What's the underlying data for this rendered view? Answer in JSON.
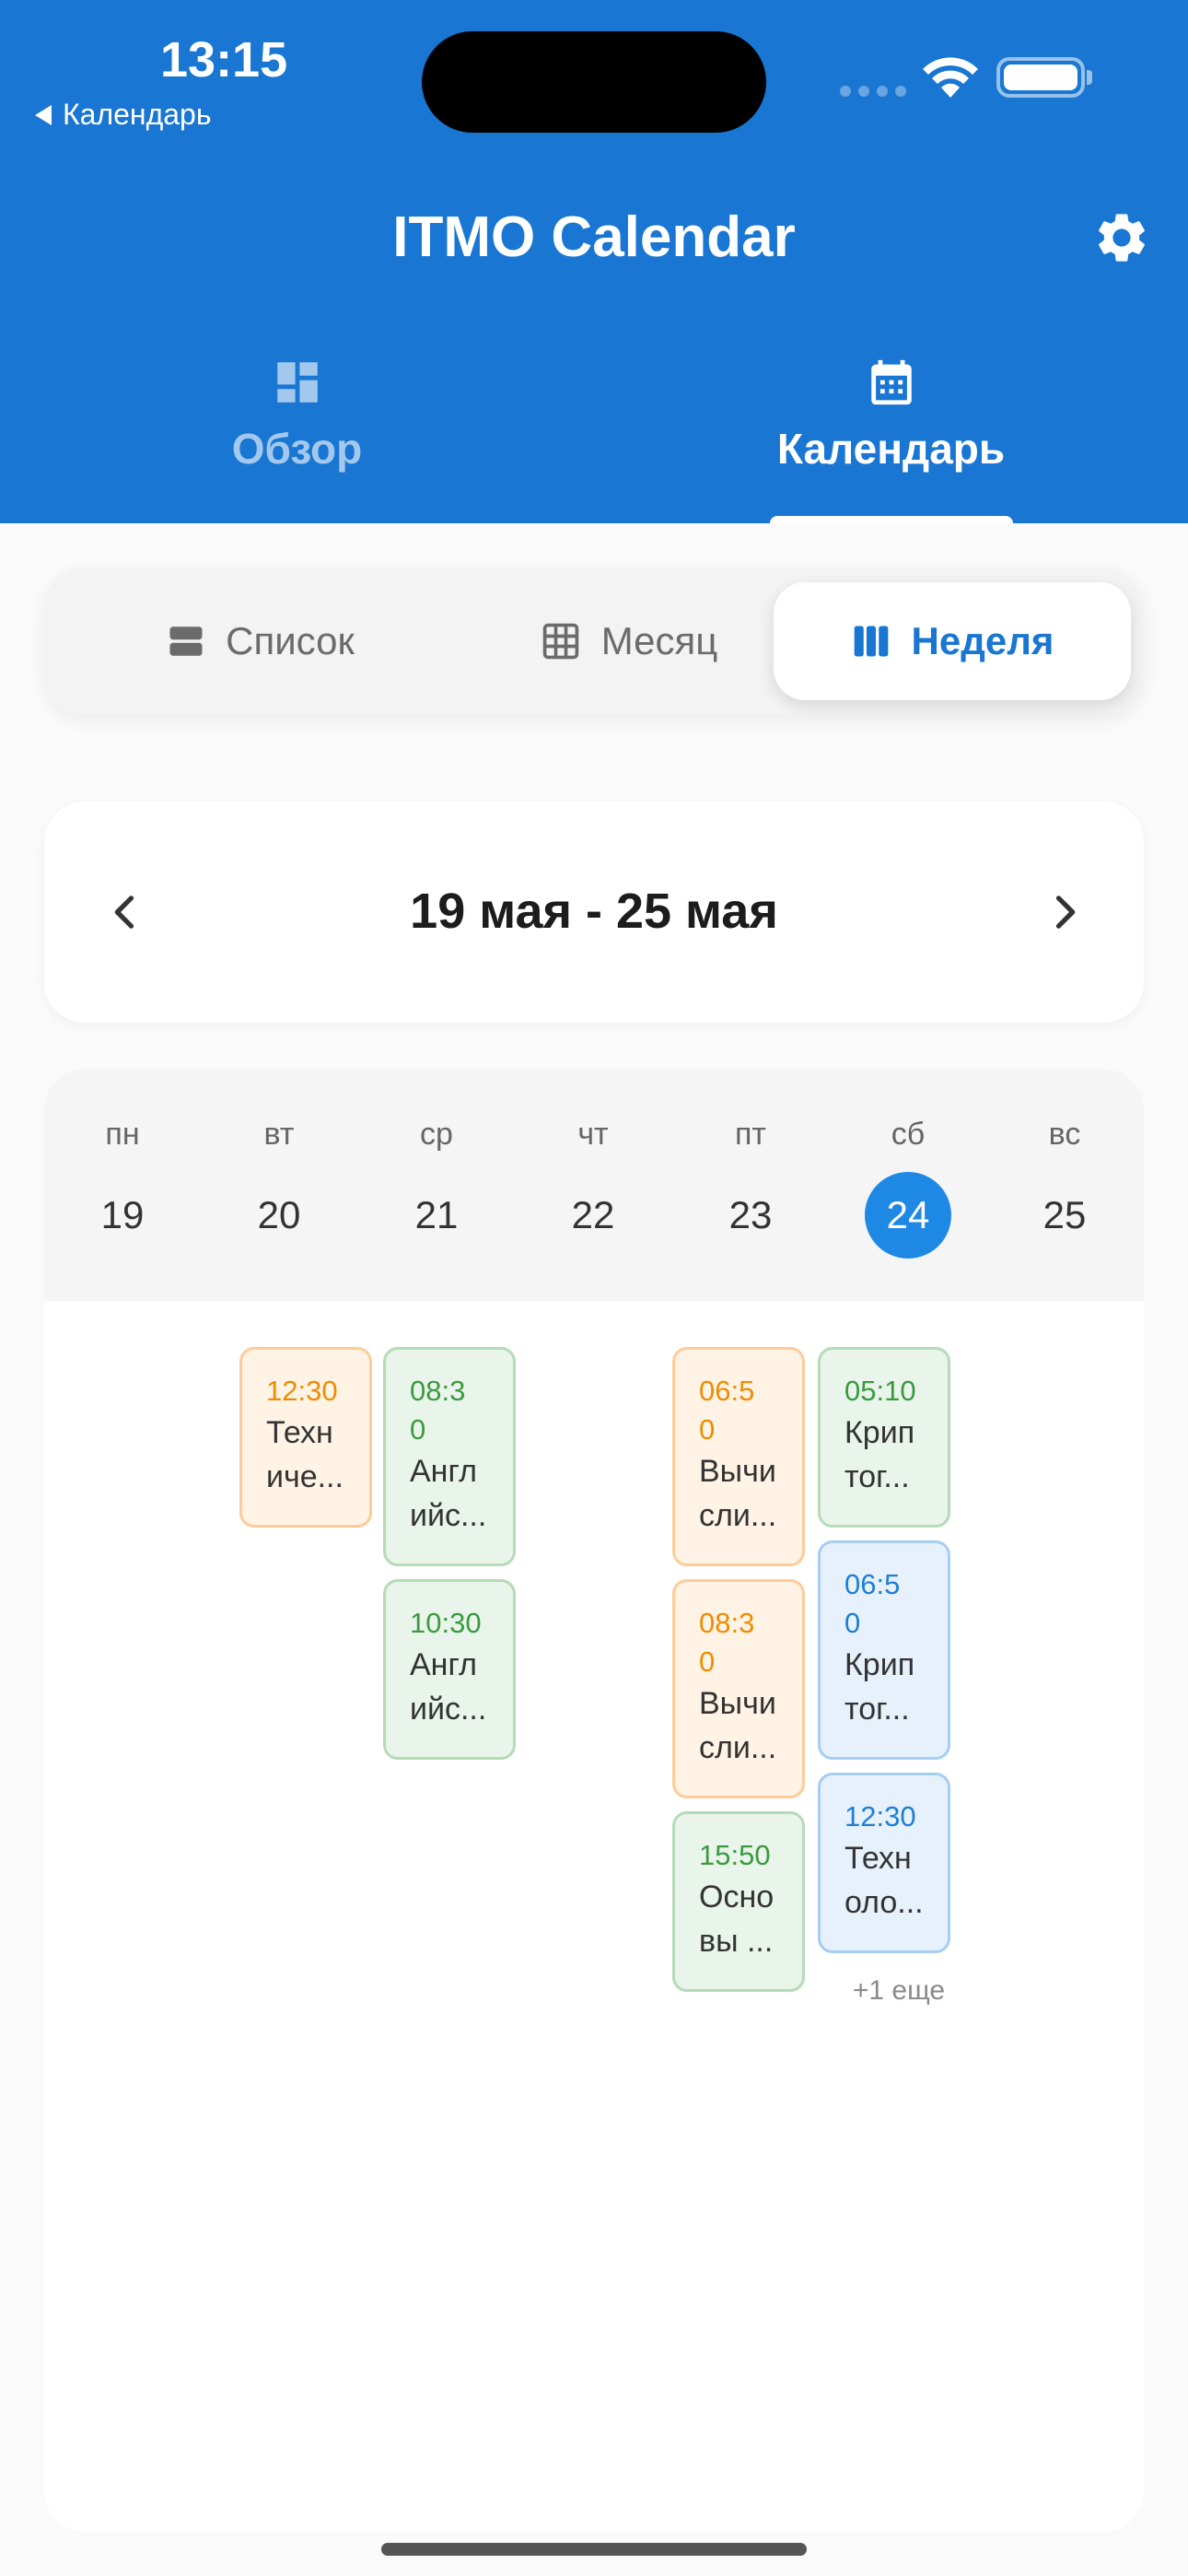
{
  "status": {
    "time": "13:15",
    "back_label": "Календарь"
  },
  "header": {
    "title": "ITMO Calendar",
    "tabs": [
      {
        "label": "Обзор",
        "icon": "dashboard-icon",
        "active": false
      },
      {
        "label": "Календарь",
        "icon": "calendar-icon",
        "active": true
      }
    ]
  },
  "view_switch": {
    "options": [
      {
        "label": "Список",
        "icon": "list-icon"
      },
      {
        "label": "Месяц",
        "icon": "grid-icon"
      },
      {
        "label": "Неделя",
        "icon": "week-columns-icon"
      }
    ],
    "selected": "Неделя"
  },
  "week_nav": {
    "range": "19 мая - 25 мая"
  },
  "week": {
    "days": [
      {
        "name": "пн",
        "num": "19"
      },
      {
        "name": "вт",
        "num": "20"
      },
      {
        "name": "ср",
        "num": "21"
      },
      {
        "name": "чт",
        "num": "22"
      },
      {
        "name": "пт",
        "num": "23"
      },
      {
        "name": "сб",
        "num": "24",
        "today": true
      },
      {
        "name": "вс",
        "num": "25"
      }
    ]
  },
  "events": {
    "tue_1": {
      "time": "12:30",
      "title_l1": "Техн",
      "title_l2": "иче...",
      "color": "#ef8c00"
    },
    "wed_1": {
      "time_l1": "08:3",
      "time_l2": "0",
      "title_l1": "Англ",
      "title_l2": "ийс...",
      "color": "#3b9a40"
    },
    "wed_2": {
      "time": "10:30",
      "title_l1": "Англ",
      "title_l2": "ийс...",
      "color": "#3b9a40"
    },
    "fri_1": {
      "time_l1": "06:5",
      "time_l2": "0",
      "title_l1": "Вычи",
      "title_l2": "сли...",
      "color": "#ef8c00"
    },
    "fri_2": {
      "time_l1": "08:3",
      "time_l2": "0",
      "title_l1": "Вычи",
      "title_l2": "сли...",
      "color": "#ef8c00"
    },
    "fri_3": {
      "time": "15:50",
      "title_l1": "Осно",
      "title_l2": "вы ...",
      "color": "#3b9a40"
    },
    "sat_1": {
      "time": "05:10",
      "title_l1": "Крип",
      "title_l2": "тог...",
      "color": "#3b9a40"
    },
    "sat_2": {
      "time_l1": "06:5",
      "time_l2": "0",
      "title_l1": "Крип",
      "title_l2": "тог...",
      "color": "#1f7fd2"
    },
    "sat_3": {
      "time": "12:30",
      "title_l1": "Техн",
      "title_l2": "оло...",
      "color": "#1f7fd2"
    },
    "sat_more": "+1 еще"
  }
}
